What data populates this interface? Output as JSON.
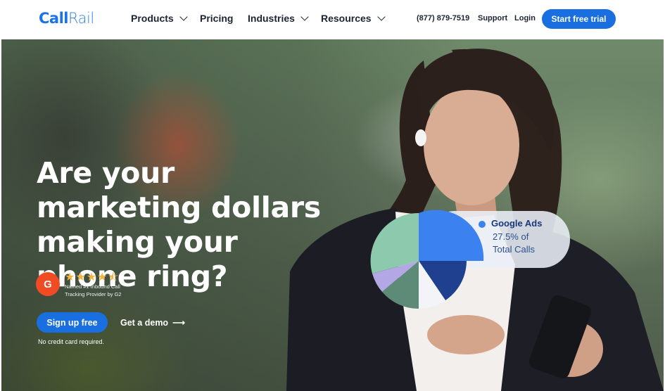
{
  "nav": {
    "logo_a": "Call",
    "logo_b": "Rail",
    "items": [
      {
        "label": "Products",
        "has_menu": true
      },
      {
        "label": "Pricing",
        "has_menu": false
      },
      {
        "label": "Industries",
        "has_menu": true
      },
      {
        "label": "Resources",
        "has_menu": true
      }
    ],
    "phone": "(877) 879-7519",
    "support": "Support",
    "login": "Login",
    "cta": "Start free trial"
  },
  "hero": {
    "headline": "Are your marketing dollars making your phone ring?",
    "rating": {
      "badge": "G",
      "stars": "★★★★⯪",
      "text": "Named #1 Inbound Call Tracking Provider by G2"
    },
    "primary_button": "Sign up free",
    "secondary_button": "Get a demo",
    "arrow": "⟶",
    "note": "No credit card required.",
    "callout": {
      "title": "Google Ads",
      "line1": "27.5% of",
      "line2": "Total Calls"
    }
  },
  "colors": {
    "accent": "#1a6fe0",
    "g2_red": "#f04b23",
    "star": "#f6b33f",
    "pie_blue": "#3b82f0",
    "pie_navy": "#1f3f8f",
    "pie_white": "#f2f4f7",
    "pie_green": "#5e8a78",
    "pie_lavender": "#b3a7e6",
    "pie_mint": "#8cc9ad"
  }
}
